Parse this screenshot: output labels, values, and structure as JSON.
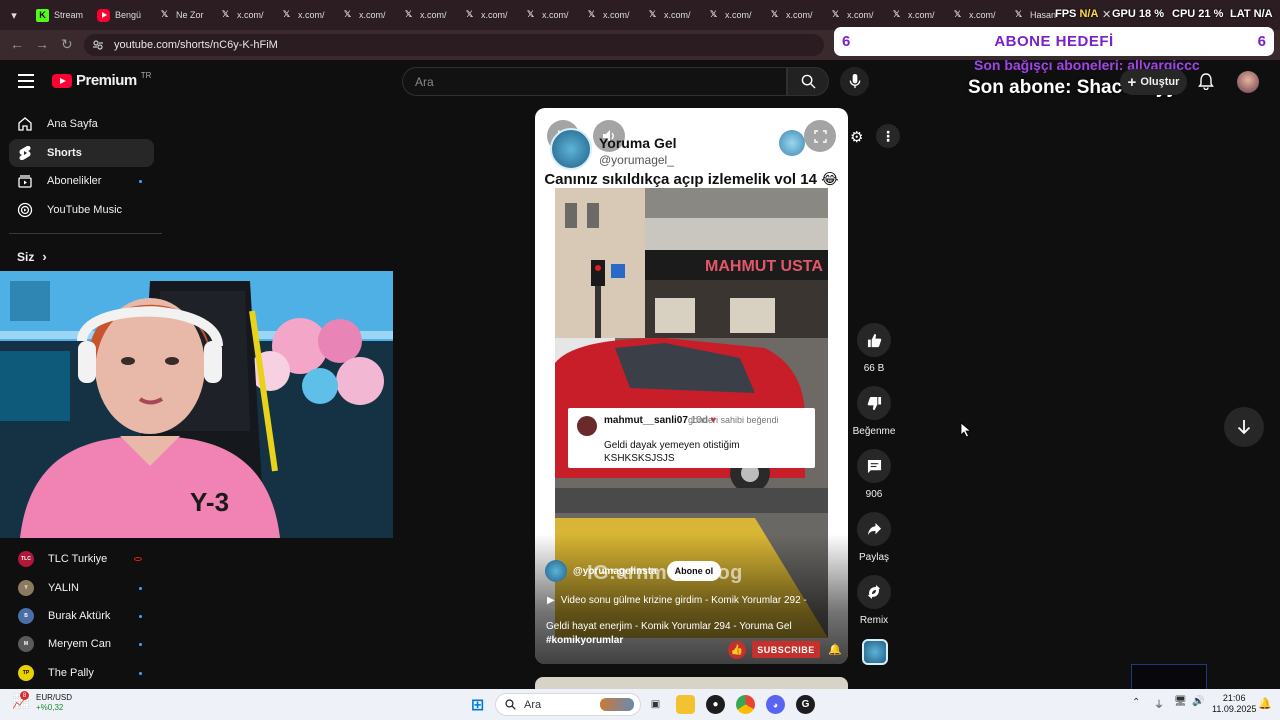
{
  "browser": {
    "tabs": [
      {
        "label": "Stream",
        "icon": "kick-icon"
      },
      {
        "label": "Bengü",
        "icon": "youtube-icon"
      },
      {
        "label": "Ne Zor",
        "icon": "x-icon"
      },
      {
        "label": "x.com/",
        "icon": "x-icon"
      },
      {
        "label": "x.com/",
        "icon": "x-icon"
      },
      {
        "label": "x.com/",
        "icon": "x-icon"
      },
      {
        "label": "x.com/",
        "icon": "x-icon"
      },
      {
        "label": "x.com/",
        "icon": "x-icon"
      },
      {
        "label": "x.com/",
        "icon": "x-icon"
      },
      {
        "label": "x.com/",
        "icon": "x-icon"
      },
      {
        "label": "x.com/",
        "icon": "x-icon"
      },
      {
        "label": "x.com/",
        "icon": "x-icon"
      },
      {
        "label": "x.com/",
        "icon": "x-icon"
      },
      {
        "label": "x.com/",
        "icon": "x-icon"
      },
      {
        "label": "x.com/",
        "icon": "x-icon"
      },
      {
        "label": "x.com/",
        "icon": "x-icon"
      },
      {
        "label": "Hasan",
        "icon": "x-icon"
      }
    ],
    "url": "youtube.com/shorts/nC6y-K-hFiM"
  },
  "overlay": {
    "fps_label": "FPS",
    "fps_value": "N/A",
    "gpu_label": "GPU",
    "gpu_value": "18 %",
    "cpu_label": "CPU",
    "cpu_value": "21 %",
    "lat_label": "LAT",
    "lat_value": "N/A",
    "goal_left": "6",
    "goal_title": "ABONE HEDEFİ",
    "goal_right": "6",
    "last_donor": "Son bağışçı aboneleri: allyargiccc",
    "last_sub": "Son abone: Shacomlyy"
  },
  "header": {
    "logo_text": "Premium",
    "logo_sup": "TR",
    "search_placeholder": "Ara",
    "create_label": "Oluştur"
  },
  "sidebar": {
    "items": [
      {
        "label": "Ana Sayfa"
      },
      {
        "label": "Shorts"
      },
      {
        "label": "Abonelikler"
      },
      {
        "label": "YouTube Music"
      }
    ],
    "you_label": "Siz",
    "subscriptions": [
      {
        "label": "TLC Turkiye",
        "initials": "TLC",
        "color": "#b0183a"
      },
      {
        "label": "YALIN",
        "initials": "Y",
        "color": "#8a7a60"
      },
      {
        "label": "Burak Aktürk",
        "initials": "B",
        "color": "#4a6ea8"
      },
      {
        "label": "Meryem Can",
        "initials": "M",
        "color": "#5a5a5a"
      },
      {
        "label": "The Pally",
        "initials": "TP",
        "color": "#e8d200"
      }
    ]
  },
  "short": {
    "channel_name": "Yoruma Gel",
    "channel_handle": "@yorumagel_",
    "video_title": "Canınız sıkıldıkça açıp izlemelik vol 14 😂",
    "sign_text": "MAHMUT USTA",
    "comment_user": "mahmut__sanli07",
    "comment_age": "10d",
    "comment_liked": "gönderi sahibi beğendi",
    "comment_text": "Geldi dayak yemeyen otistiğim KSHKSKSJSJS",
    "watermark": "IG:arnmotovlog",
    "owner_handle": "@yorumagelinsta",
    "follow_label": "Abone ol",
    "playlist_text": "Video sonu gülme krizine girdim - Komik Yorumlar 292 -",
    "description": "Geldi hayat enerjim - Komik Yorumlar 294 - Yoruma Gel",
    "hashtag": "#komikyorumlar",
    "subscribe_badge": "SUBSCRIBE"
  },
  "actions": {
    "like_count": "66 B",
    "dislike_label": "Beğenme",
    "comment_count": "906",
    "share_label": "Paylaş",
    "remix_label": "Remix"
  },
  "taskbar": {
    "ticker_pair": "EUR/USD",
    "ticker_change": "+%0,32",
    "ticker_badge": "8",
    "search_label": "Ara",
    "time": "21:06",
    "date": "11.09.2025"
  }
}
